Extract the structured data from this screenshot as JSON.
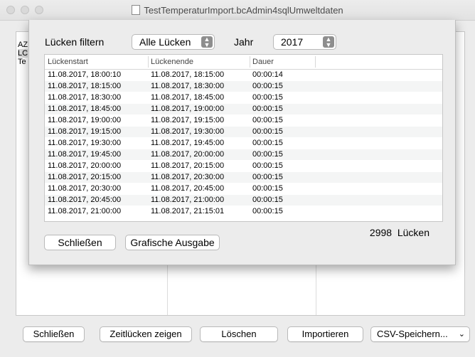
{
  "window": {
    "title": "TestTemperaturImport.bcAdmin4sqlUmweltdaten"
  },
  "background_list": {
    "items": [
      "AZ",
      "LC",
      "Te"
    ]
  },
  "bottom_buttons": {
    "close": "Schließen",
    "show_gaps": "Zeitlücken zeigen",
    "delete": "Löschen",
    "import": "Importieren",
    "csv_save": "CSV-Speichern..."
  },
  "sheet": {
    "filter_label": "Lücken filtern",
    "filter_value": "Alle Lücken",
    "year_label": "Jahr",
    "year_value": "2017",
    "columns": [
      "Lückenstart",
      "Lückenende",
      "Dauer"
    ],
    "rows": [
      [
        "11.08.2017, 18:00:10",
        "11.08.2017, 18:15:00",
        "00:00:14"
      ],
      [
        "11.08.2017, 18:15:00",
        "11.08.2017, 18:30:00",
        "00:00:15"
      ],
      [
        "11.08.2017, 18:30:00",
        "11.08.2017, 18:45:00",
        "00:00:15"
      ],
      [
        "11.08.2017, 18:45:00",
        "11.08.2017, 19:00:00",
        "00:00:15"
      ],
      [
        "11.08.2017, 19:00:00",
        "11.08.2017, 19:15:00",
        "00:00:15"
      ],
      [
        "11.08.2017, 19:15:00",
        "11.08.2017, 19:30:00",
        "00:00:15"
      ],
      [
        "11.08.2017, 19:30:00",
        "11.08.2017, 19:45:00",
        "00:00:15"
      ],
      [
        "11.08.2017, 19:45:00",
        "11.08.2017, 20:00:00",
        "00:00:15"
      ],
      [
        "11.08.2017, 20:00:00",
        "11.08.2017, 20:15:00",
        "00:00:15"
      ],
      [
        "11.08.2017, 20:15:00",
        "11.08.2017, 20:30:00",
        "00:00:15"
      ],
      [
        "11.08.2017, 20:30:00",
        "11.08.2017, 20:45:00",
        "00:00:15"
      ],
      [
        "11.08.2017, 20:45:00",
        "11.08.2017, 21:00:00",
        "00:00:15"
      ],
      [
        "11.08.2017, 21:00:00",
        "11.08.2017, 21:15:01",
        "00:00:15"
      ]
    ],
    "count_value": "2998",
    "count_label": "Lücken",
    "close_button": "Schließen",
    "graphic_button": "Grafische Ausgabe"
  }
}
